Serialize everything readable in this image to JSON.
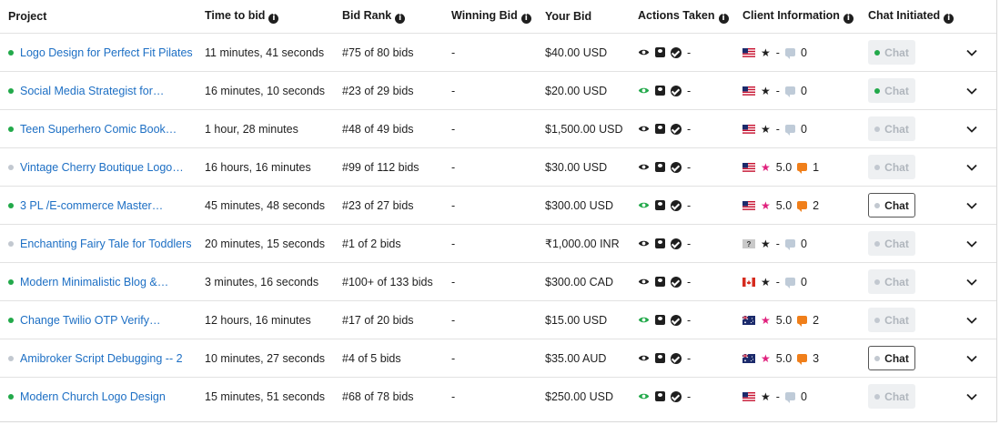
{
  "headers": {
    "project": "Project",
    "time_to_bid": "Time to bid",
    "bid_rank": "Bid Rank",
    "winning_bid": "Winning Bid",
    "your_bid": "Your Bid",
    "actions_taken": "Actions Taken",
    "client_information": "Client Information",
    "chat_initiated": "Chat Initiated"
  },
  "info_glyph": "i",
  "chat_label": "Chat",
  "colors": {
    "link": "#1d6fc4",
    "active_dot": "#22a94a",
    "inactive_dot": "#c2c8d0",
    "rating_star": "#e0217d",
    "message_icon": "#f07f1a"
  },
  "rows": [
    {
      "status": "green",
      "project": "Logo Design for Perfect Fit Pilates",
      "time": "11 minutes, 41 seconds",
      "rank": "#75 of 80 bids",
      "winning": "-",
      "your_bid": "$40.00 USD",
      "viewed": false,
      "actions_extra": "-",
      "flag": "us",
      "star": "black",
      "rating": "-",
      "msg": "grey",
      "messages": "0",
      "chat_enabled": false,
      "chat_dot": "green"
    },
    {
      "status": "green",
      "project": "Social Media Strategist for…",
      "time": "16 minutes, 10 seconds",
      "rank": "#23 of 29 bids",
      "winning": "-",
      "your_bid": "$20.00 USD",
      "viewed": true,
      "actions_extra": "-",
      "flag": "us",
      "star": "black",
      "rating": "-",
      "msg": "grey",
      "messages": "0",
      "chat_enabled": false,
      "chat_dot": "green"
    },
    {
      "status": "green",
      "project": "Teen Superhero Comic Book…",
      "time": "1 hour, 28 minutes",
      "rank": "#48 of 49 bids",
      "winning": "-",
      "your_bid": "$1,500.00 USD",
      "viewed": false,
      "actions_extra": "-",
      "flag": "us",
      "star": "black",
      "rating": "-",
      "msg": "grey",
      "messages": "0",
      "chat_enabled": false,
      "chat_dot": "grey"
    },
    {
      "status": "grey",
      "project": "Vintage Cherry Boutique Logo…",
      "time": "16 hours, 16 minutes",
      "rank": "#99 of 112 bids",
      "winning": "-",
      "your_bid": "$30.00 USD",
      "viewed": false,
      "actions_extra": "-",
      "flag": "us",
      "star": "pink",
      "rating": "5.0",
      "msg": "orange",
      "messages": "1",
      "chat_enabled": false,
      "chat_dot": "grey"
    },
    {
      "status": "green",
      "project": "3 PL /E-commerce Master…",
      "time": "45 minutes, 48 seconds",
      "rank": "#23 of 27 bids",
      "winning": "-",
      "your_bid": "$300.00 USD",
      "viewed": true,
      "actions_extra": "-",
      "flag": "us",
      "star": "pink",
      "rating": "5.0",
      "msg": "orange",
      "messages": "2",
      "chat_enabled": true,
      "chat_dot": "grey"
    },
    {
      "status": "grey",
      "project": "Enchanting Fairy Tale for Toddlers",
      "time": "20 minutes, 15 seconds",
      "rank": "#1 of 2 bids",
      "winning": "-",
      "your_bid": "₹1,000.00 INR",
      "viewed": false,
      "actions_extra": "-",
      "flag": "unknown",
      "flag_text": "?",
      "star": "black",
      "rating": "-",
      "msg": "grey",
      "messages": "0",
      "chat_enabled": false,
      "chat_dot": "grey"
    },
    {
      "status": "green",
      "project": "Modern Minimalistic Blog &…",
      "time": "3 minutes, 16 seconds",
      "rank": "#100+ of 133 bids",
      "winning": "-",
      "your_bid": "$300.00 CAD",
      "viewed": false,
      "actions_extra": "-",
      "flag": "ca",
      "star": "black",
      "rating": "-",
      "msg": "grey",
      "messages": "0",
      "chat_enabled": false,
      "chat_dot": "grey"
    },
    {
      "status": "green",
      "project": "Change Twilio OTP Verify…",
      "time": "12 hours, 16 minutes",
      "rank": "#17 of 20 bids",
      "winning": "-",
      "your_bid": "$15.00 USD",
      "viewed": true,
      "actions_extra": "-",
      "flag": "au",
      "star": "pink",
      "rating": "5.0",
      "msg": "orange",
      "messages": "2",
      "chat_enabled": false,
      "chat_dot": "grey"
    },
    {
      "status": "grey",
      "project": "Amibroker Script Debugging -- 2",
      "time": "10 minutes, 27 seconds",
      "rank": "#4 of 5 bids",
      "winning": "-",
      "your_bid": "$35.00 AUD",
      "viewed": false,
      "actions_extra": "-",
      "flag": "au",
      "star": "pink",
      "rating": "5.0",
      "msg": "orange",
      "messages": "3",
      "chat_enabled": true,
      "chat_dot": "grey"
    },
    {
      "status": "green",
      "project": "Modern Church Logo Design",
      "time": "15 minutes, 51 seconds",
      "rank": "#68 of 78 bids",
      "winning": "-",
      "your_bid": "$250.00 USD",
      "viewed": true,
      "actions_extra": "-",
      "flag": "us",
      "star": "black",
      "rating": "-",
      "msg": "grey",
      "messages": "0",
      "chat_enabled": false,
      "chat_dot": "grey"
    }
  ]
}
